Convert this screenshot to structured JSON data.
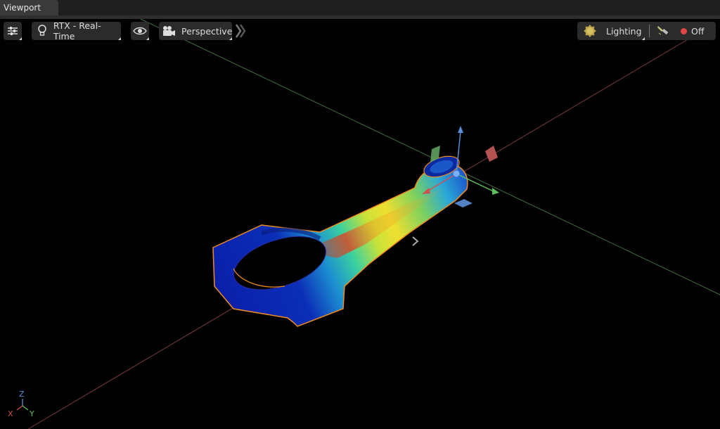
{
  "window": {
    "tab_title": "Viewport"
  },
  "toolbar": {
    "settings_icon": "sliders-icon",
    "renderer_label": "RTX - Real-Time",
    "renderer_icon": "lightbulb-icon",
    "visibility_icon": "eye-icon",
    "camera_label": "Perspective",
    "camera_icon": "movie-camera-icon",
    "expand_icon": "double-chevron-right-icon",
    "lighting_label": "Lighting",
    "lighting_icon": "sun-icon",
    "light_tool_icon": "flashlight-icon",
    "record_label": "Off",
    "record_color": "#e04848"
  },
  "axes_widget": {
    "z": "Z",
    "x": "X",
    "y": "Y",
    "x_color": "#d05050",
    "y_color": "#5fbf5f",
    "z_color": "#5a8fd8"
  },
  "selection_outline_color": "#f08c1e"
}
